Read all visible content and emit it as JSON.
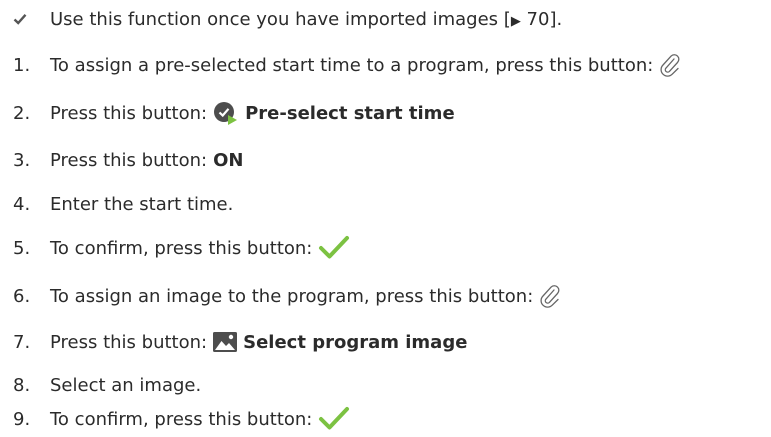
{
  "prerequisite": {
    "text_before": "Use this function once you have imported images [",
    "ref_arrow": "▶",
    "ref_page": " 70",
    "text_after": "]."
  },
  "steps": [
    {
      "num": "1.",
      "text": "To assign a pre-selected start time to a program, press this button:",
      "icon": "paperclip-icon"
    },
    {
      "num": "2.",
      "text": "Press this button:",
      "icon": "clock-check-icon",
      "bold": "Pre-select start time"
    },
    {
      "num": "3.",
      "text": "Press this button:",
      "bold": "ON"
    },
    {
      "num": "4.",
      "text": "Enter the start time."
    },
    {
      "num": "5.",
      "text": "To confirm, press this button:",
      "icon": "checkmark-icon"
    },
    {
      "num": "6.",
      "text": "To assign an image to the program, press this button:",
      "icon": "paperclip-icon"
    },
    {
      "num": "7.",
      "text": "Press this button:",
      "icon": "image-icon",
      "bold": "Select program image"
    },
    {
      "num": "8.",
      "text": "Select an image."
    },
    {
      "num": "9.",
      "text": "To confirm, press this button:",
      "icon": "checkmark-icon"
    }
  ],
  "colors": {
    "check_green": "#7cc242",
    "text": "#2b2b2b",
    "icon_dark": "#555555"
  }
}
